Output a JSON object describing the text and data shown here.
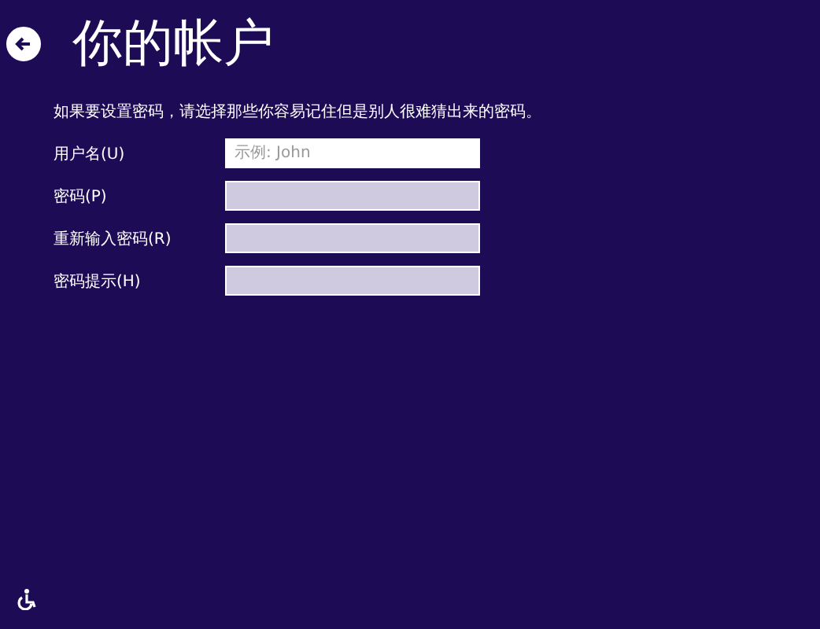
{
  "title": "你的帐户",
  "description": "如果要设置密码，请选择那些你容易记住但是别人很难猜出来的密码。",
  "fields": [
    {
      "label": "用户名(U)",
      "placeholder": "示例: John",
      "focused": true
    },
    {
      "label": "密码(P)",
      "focused": false
    },
    {
      "label": "重新输入密码(R)",
      "focused": false
    },
    {
      "label": "密码提示(H)",
      "focused": false
    }
  ]
}
